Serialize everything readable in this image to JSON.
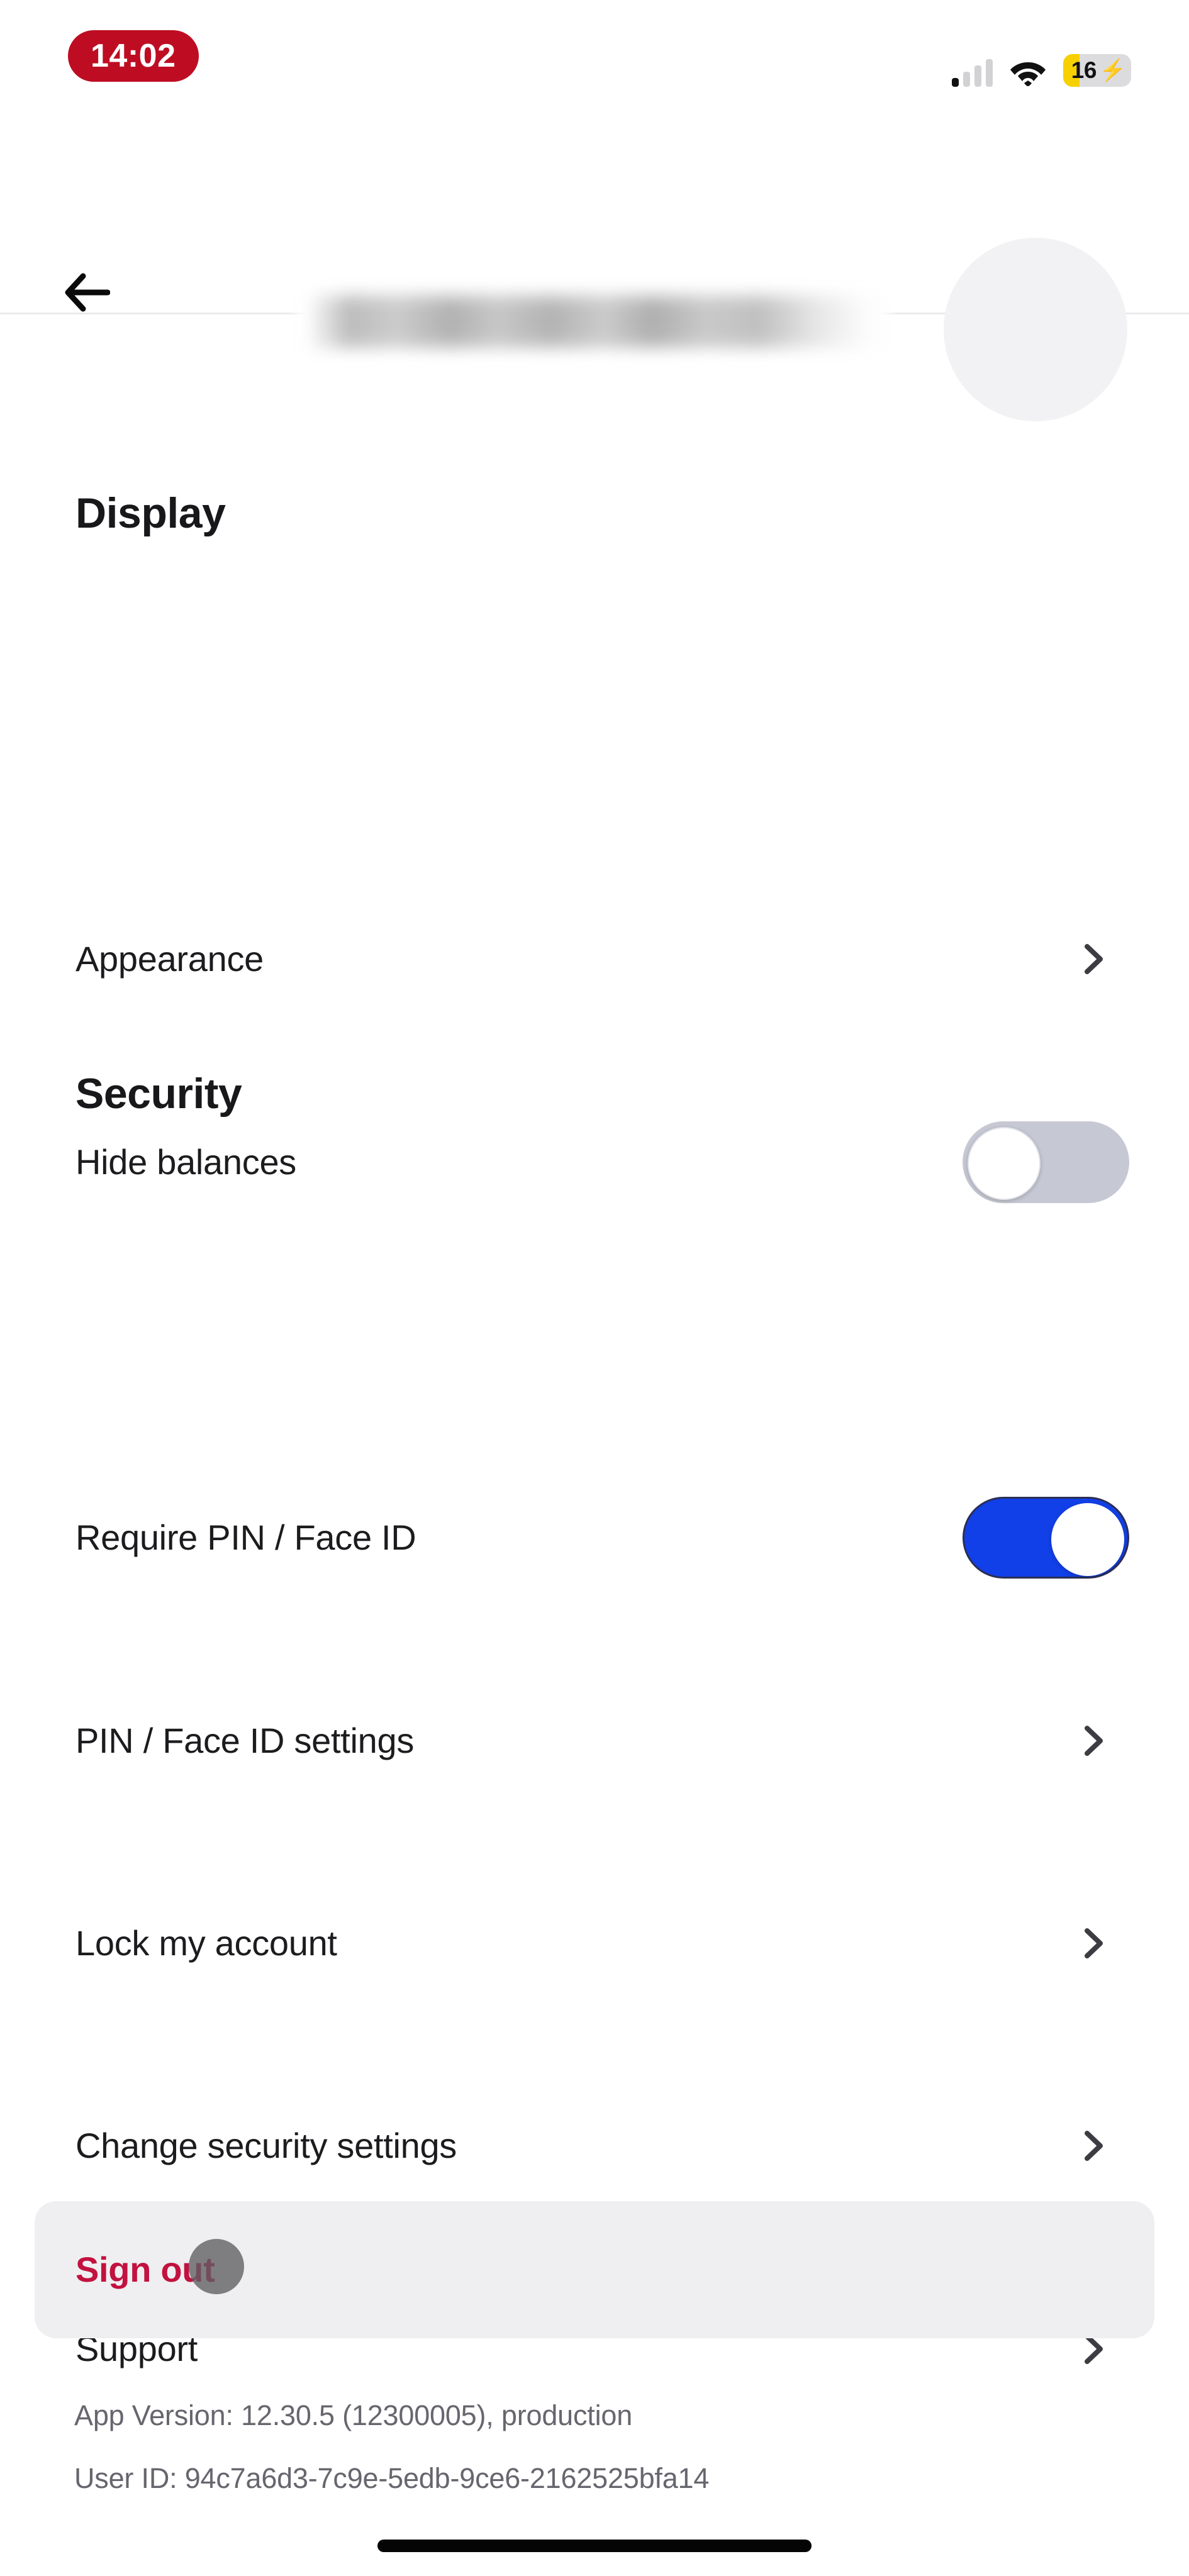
{
  "status_bar": {
    "time": "14:02",
    "signal_icon": "cellular-signal-icon",
    "signal_bars_total": 4,
    "signal_bars_active": 1,
    "wifi_icon": "wifi-icon",
    "battery_icon": "battery-charging-icon",
    "battery_percent": "16",
    "battery_charging_glyph": "⚡",
    "clock_badge_color": "#BE0D22",
    "battery_fill_color": "#F7D000"
  },
  "header": {
    "back_icon": "back-arrow-icon",
    "title_redacted": true,
    "avatar_icon": "avatar"
  },
  "sections": [
    {
      "heading": "Display",
      "rows": [
        {
          "label": "Appearance",
          "control": "chevron",
          "name": "appearance"
        },
        {
          "label": "Hide balances",
          "control": "toggle",
          "state": "off",
          "name": "hide-balances"
        }
      ]
    },
    {
      "heading": "Security",
      "rows": [
        {
          "label": "Require PIN / Face ID",
          "control": "toggle",
          "state": "on",
          "name": "require-pin-face-id"
        },
        {
          "label": "PIN / Face ID settings",
          "control": "chevron",
          "name": "pin-face-id-settings"
        },
        {
          "label": "Lock my account",
          "control": "chevron",
          "name": "lock-my-account"
        },
        {
          "label": "Change security settings",
          "control": "chevron",
          "name": "change-security-settings"
        },
        {
          "label": "Support",
          "control": "chevron",
          "name": "support"
        }
      ]
    }
  ],
  "sign_out": {
    "label": "Sign out",
    "color": "#C2123F"
  },
  "footer": {
    "app_version": "App Version: 12.30.5 (12300005), production",
    "user_id": "User ID: 94c7a6d3-7c9e-5edb-9ce6-2162525bfa14"
  },
  "colors": {
    "toggle_on": "#1140E8",
    "toggle_off": "#C6C8D3",
    "accent_red": "#BE0D22",
    "card_bg": "#EFEFF1"
  }
}
